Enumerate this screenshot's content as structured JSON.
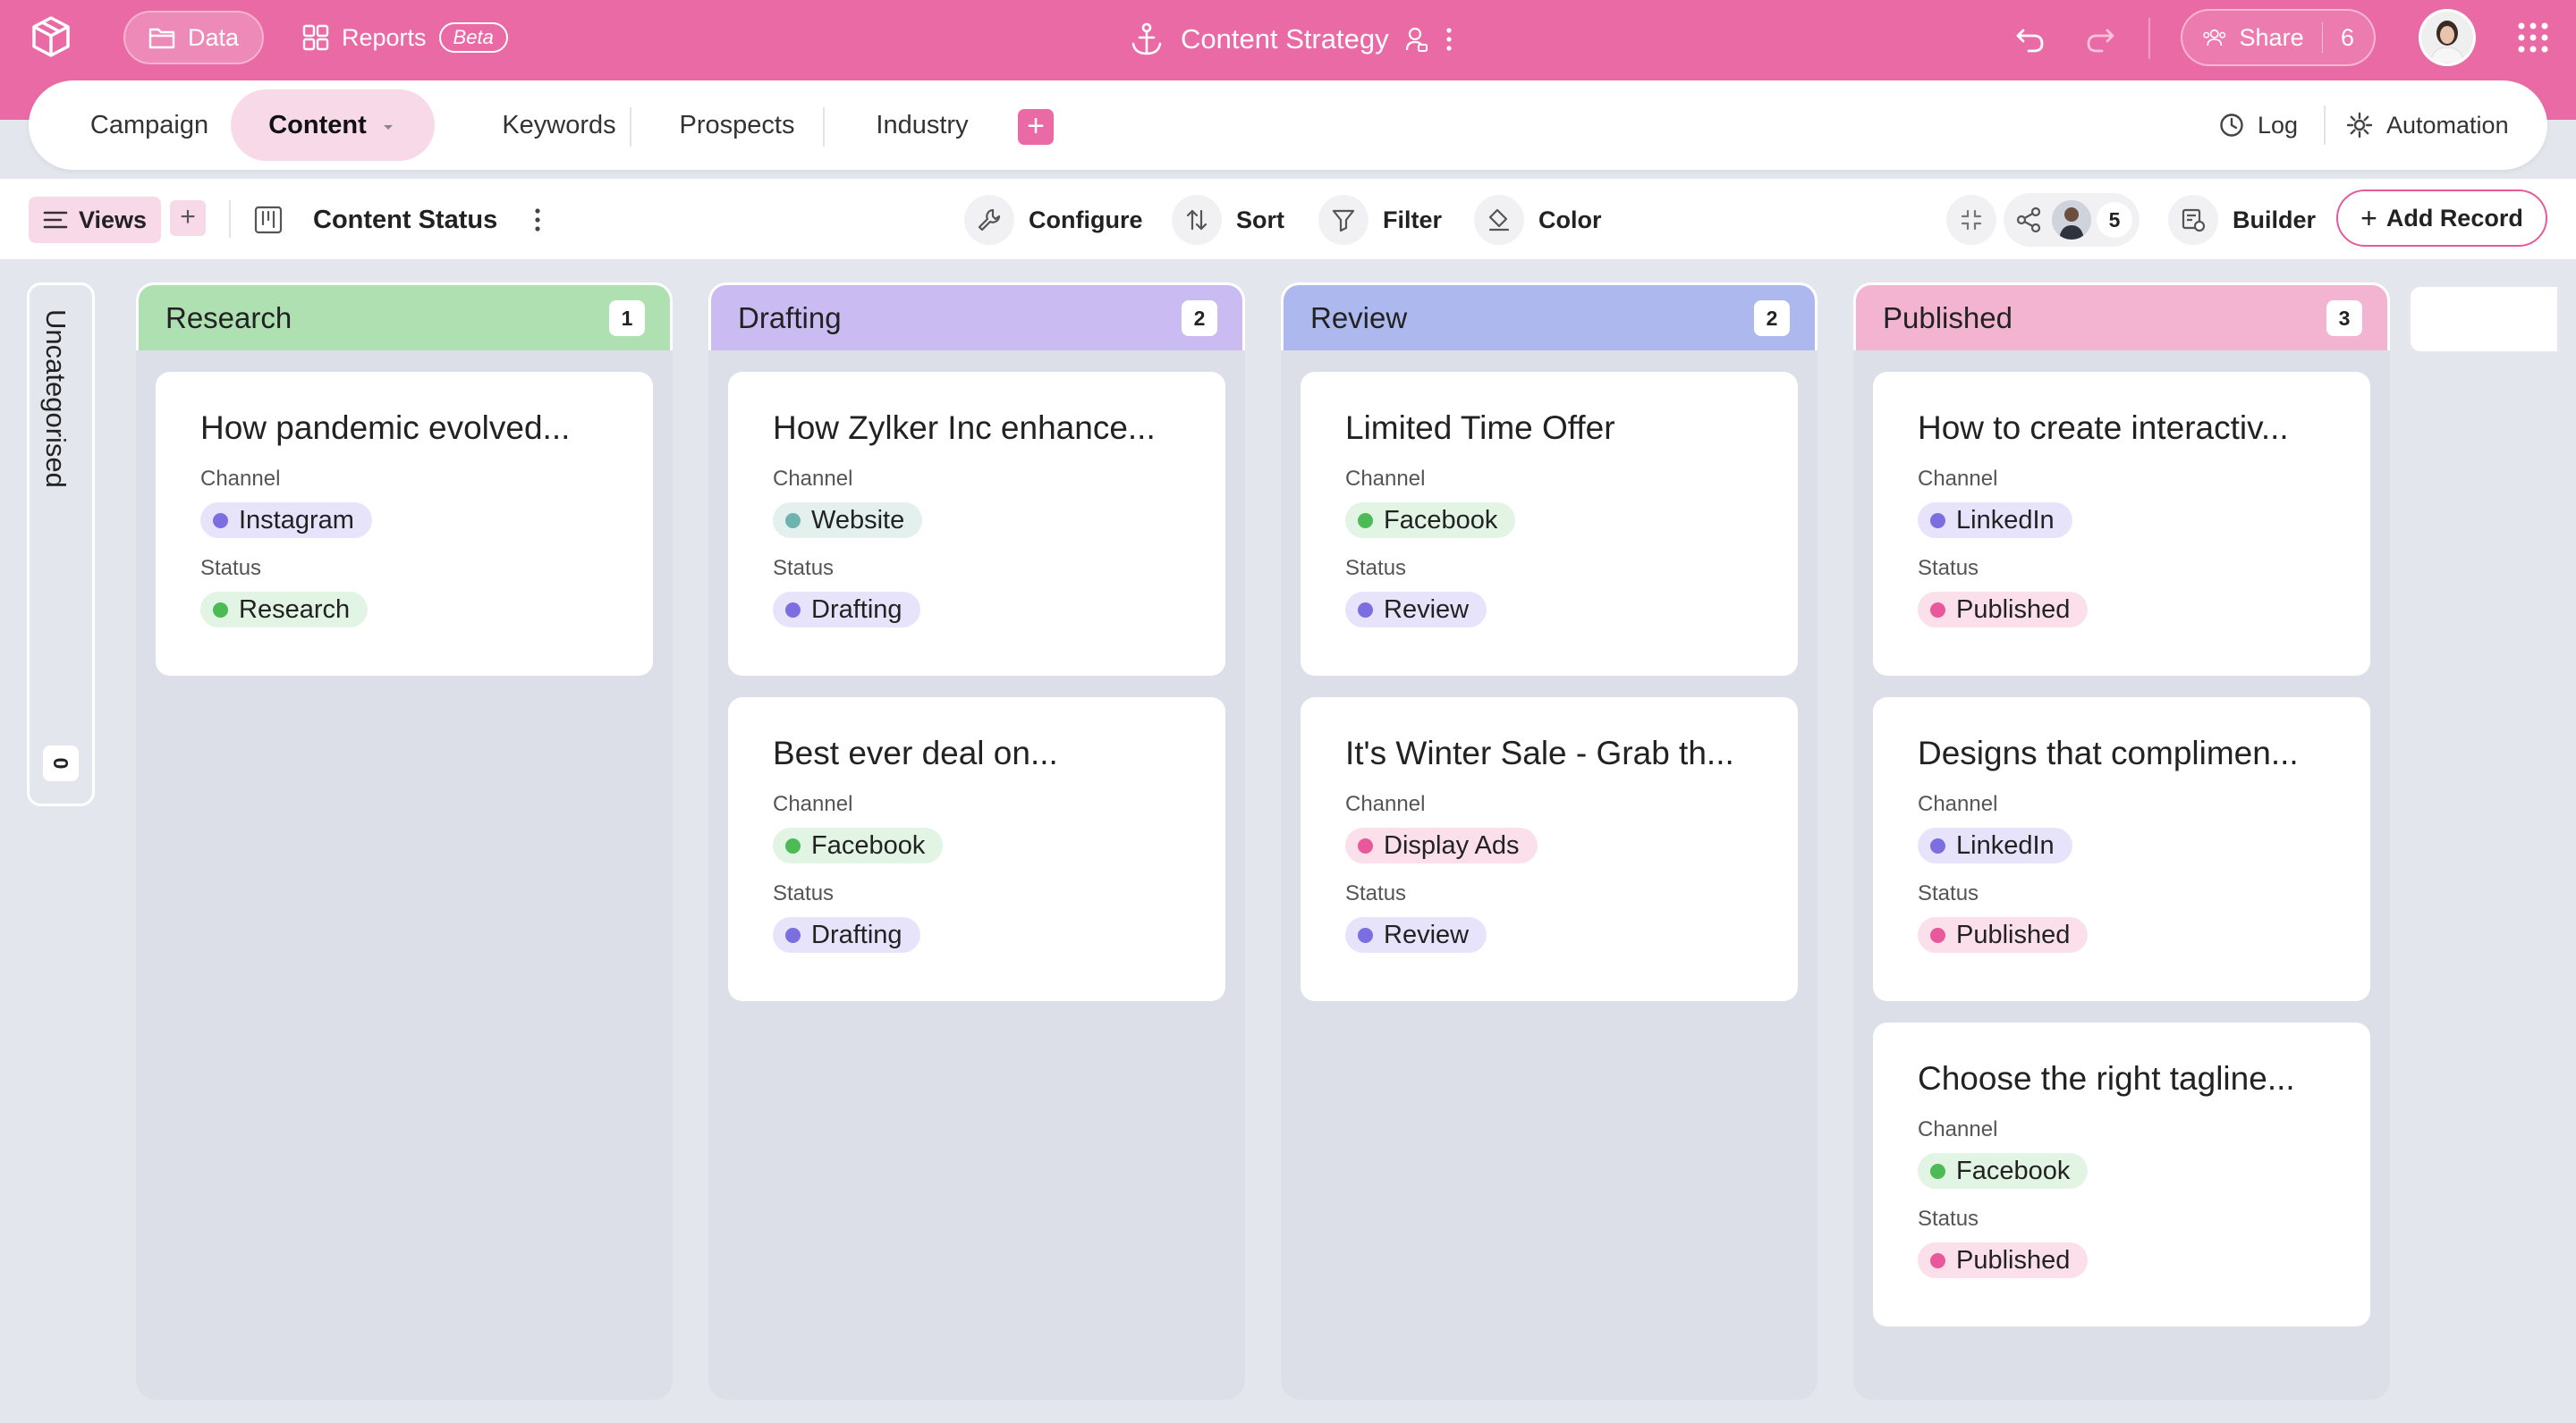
{
  "colors": {
    "brand": "#ea6aa5",
    "tab_active_bg": "#f7d9e8",
    "research": "#aee0b1",
    "drafting": "#cabcf3",
    "review": "#adb8ee",
    "published": "#f2b4d1",
    "dot_green": "#4cbb55",
    "dot_purple": "#7b6ee0",
    "dot_pink": "#e8589a",
    "dot_teal": "#6fb3b0"
  },
  "topbar": {
    "data_label": "Data",
    "reports_label": "Reports",
    "beta_label": "Beta",
    "title": "Content Strategy",
    "share_label": "Share",
    "share_count": "6"
  },
  "tabs": {
    "items": [
      "Campaign",
      "Content",
      "Keywords",
      "Prospects",
      "Industry"
    ],
    "log_label": "Log",
    "automation_label": "Automation"
  },
  "toolbar": {
    "views_label": "Views",
    "view_name": "Content Status",
    "configure_label": "Configure",
    "sort_label": "Sort",
    "filter_label": "Filter",
    "color_label": "Color",
    "collab_count": "5",
    "builder_label": "Builder",
    "add_record_label": "Add Record"
  },
  "board": {
    "uncategorised_label": "Uncategorised",
    "uncategorised_count": "0",
    "field_channel": "Channel",
    "field_status": "Status",
    "columns": [
      {
        "name": "Research",
        "count": "1",
        "cards": [
          {
            "title": "How pandemic evolved...",
            "channel": "Instagram",
            "status": "Research"
          }
        ]
      },
      {
        "name": "Drafting",
        "count": "2",
        "cards": [
          {
            "title": "How Zylker Inc enhance...",
            "channel": "Website",
            "status": "Drafting"
          },
          {
            "title": "Best ever deal on...",
            "channel": "Facebook",
            "status": "Drafting"
          }
        ]
      },
      {
        "name": "Review",
        "count": "2",
        "cards": [
          {
            "title": "Limited Time Offer",
            "channel": "Facebook",
            "status": "Review"
          },
          {
            "title": "It's Winter Sale - Grab th...",
            "channel": "Display Ads",
            "status": "Review"
          }
        ]
      },
      {
        "name": "Published",
        "count": "3",
        "cards": [
          {
            "title": "How to create interactiv...",
            "channel": "LinkedIn",
            "status": "Published"
          },
          {
            "title": "Designs that complimen...",
            "channel": "LinkedIn",
            "status": "Published"
          },
          {
            "title": "Choose the right tagline...",
            "channel": "Facebook",
            "status": "Published"
          }
        ]
      }
    ]
  }
}
